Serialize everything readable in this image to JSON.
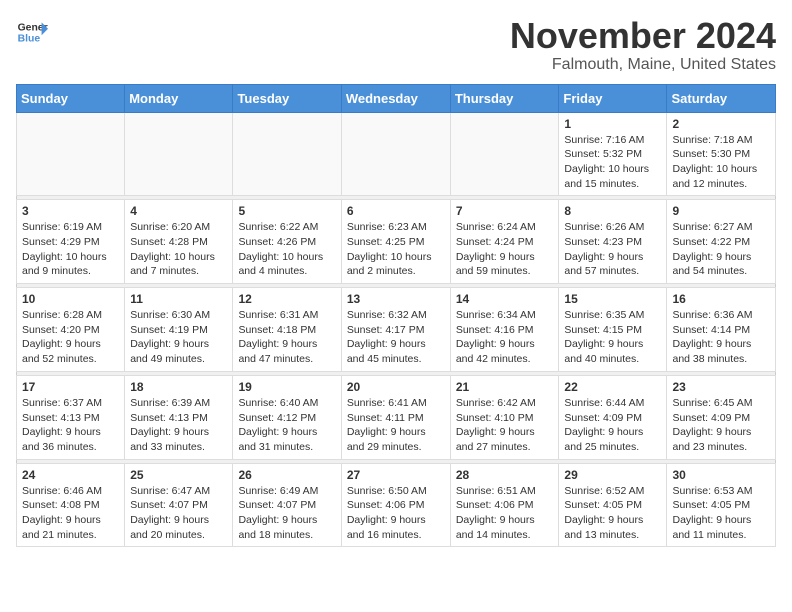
{
  "logo": {
    "line1": "General",
    "line2": "Blue"
  },
  "title": "November 2024",
  "location": "Falmouth, Maine, United States",
  "weekdays": [
    "Sunday",
    "Monday",
    "Tuesday",
    "Wednesday",
    "Thursday",
    "Friday",
    "Saturday"
  ],
  "weeks": [
    [
      {
        "day": "",
        "info": ""
      },
      {
        "day": "",
        "info": ""
      },
      {
        "day": "",
        "info": ""
      },
      {
        "day": "",
        "info": ""
      },
      {
        "day": "",
        "info": ""
      },
      {
        "day": "1",
        "info": "Sunrise: 7:16 AM\nSunset: 5:32 PM\nDaylight: 10 hours and 15 minutes."
      },
      {
        "day": "2",
        "info": "Sunrise: 7:18 AM\nSunset: 5:30 PM\nDaylight: 10 hours and 12 minutes."
      }
    ],
    [
      {
        "day": "3",
        "info": "Sunrise: 6:19 AM\nSunset: 4:29 PM\nDaylight: 10 hours and 9 minutes."
      },
      {
        "day": "4",
        "info": "Sunrise: 6:20 AM\nSunset: 4:28 PM\nDaylight: 10 hours and 7 minutes."
      },
      {
        "day": "5",
        "info": "Sunrise: 6:22 AM\nSunset: 4:26 PM\nDaylight: 10 hours and 4 minutes."
      },
      {
        "day": "6",
        "info": "Sunrise: 6:23 AM\nSunset: 4:25 PM\nDaylight: 10 hours and 2 minutes."
      },
      {
        "day": "7",
        "info": "Sunrise: 6:24 AM\nSunset: 4:24 PM\nDaylight: 9 hours and 59 minutes."
      },
      {
        "day": "8",
        "info": "Sunrise: 6:26 AM\nSunset: 4:23 PM\nDaylight: 9 hours and 57 minutes."
      },
      {
        "day": "9",
        "info": "Sunrise: 6:27 AM\nSunset: 4:22 PM\nDaylight: 9 hours and 54 minutes."
      }
    ],
    [
      {
        "day": "10",
        "info": "Sunrise: 6:28 AM\nSunset: 4:20 PM\nDaylight: 9 hours and 52 minutes."
      },
      {
        "day": "11",
        "info": "Sunrise: 6:30 AM\nSunset: 4:19 PM\nDaylight: 9 hours and 49 minutes."
      },
      {
        "day": "12",
        "info": "Sunrise: 6:31 AM\nSunset: 4:18 PM\nDaylight: 9 hours and 47 minutes."
      },
      {
        "day": "13",
        "info": "Sunrise: 6:32 AM\nSunset: 4:17 PM\nDaylight: 9 hours and 45 minutes."
      },
      {
        "day": "14",
        "info": "Sunrise: 6:34 AM\nSunset: 4:16 PM\nDaylight: 9 hours and 42 minutes."
      },
      {
        "day": "15",
        "info": "Sunrise: 6:35 AM\nSunset: 4:15 PM\nDaylight: 9 hours and 40 minutes."
      },
      {
        "day": "16",
        "info": "Sunrise: 6:36 AM\nSunset: 4:14 PM\nDaylight: 9 hours and 38 minutes."
      }
    ],
    [
      {
        "day": "17",
        "info": "Sunrise: 6:37 AM\nSunset: 4:13 PM\nDaylight: 9 hours and 36 minutes."
      },
      {
        "day": "18",
        "info": "Sunrise: 6:39 AM\nSunset: 4:13 PM\nDaylight: 9 hours and 33 minutes."
      },
      {
        "day": "19",
        "info": "Sunrise: 6:40 AM\nSunset: 4:12 PM\nDaylight: 9 hours and 31 minutes."
      },
      {
        "day": "20",
        "info": "Sunrise: 6:41 AM\nSunset: 4:11 PM\nDaylight: 9 hours and 29 minutes."
      },
      {
        "day": "21",
        "info": "Sunrise: 6:42 AM\nSunset: 4:10 PM\nDaylight: 9 hours and 27 minutes."
      },
      {
        "day": "22",
        "info": "Sunrise: 6:44 AM\nSunset: 4:09 PM\nDaylight: 9 hours and 25 minutes."
      },
      {
        "day": "23",
        "info": "Sunrise: 6:45 AM\nSunset: 4:09 PM\nDaylight: 9 hours and 23 minutes."
      }
    ],
    [
      {
        "day": "24",
        "info": "Sunrise: 6:46 AM\nSunset: 4:08 PM\nDaylight: 9 hours and 21 minutes."
      },
      {
        "day": "25",
        "info": "Sunrise: 6:47 AM\nSunset: 4:07 PM\nDaylight: 9 hours and 20 minutes."
      },
      {
        "day": "26",
        "info": "Sunrise: 6:49 AM\nSunset: 4:07 PM\nDaylight: 9 hours and 18 minutes."
      },
      {
        "day": "27",
        "info": "Sunrise: 6:50 AM\nSunset: 4:06 PM\nDaylight: 9 hours and 16 minutes."
      },
      {
        "day": "28",
        "info": "Sunrise: 6:51 AM\nSunset: 4:06 PM\nDaylight: 9 hours and 14 minutes."
      },
      {
        "day": "29",
        "info": "Sunrise: 6:52 AM\nSunset: 4:05 PM\nDaylight: 9 hours and 13 minutes."
      },
      {
        "day": "30",
        "info": "Sunrise: 6:53 AM\nSunset: 4:05 PM\nDaylight: 9 hours and 11 minutes."
      }
    ]
  ]
}
